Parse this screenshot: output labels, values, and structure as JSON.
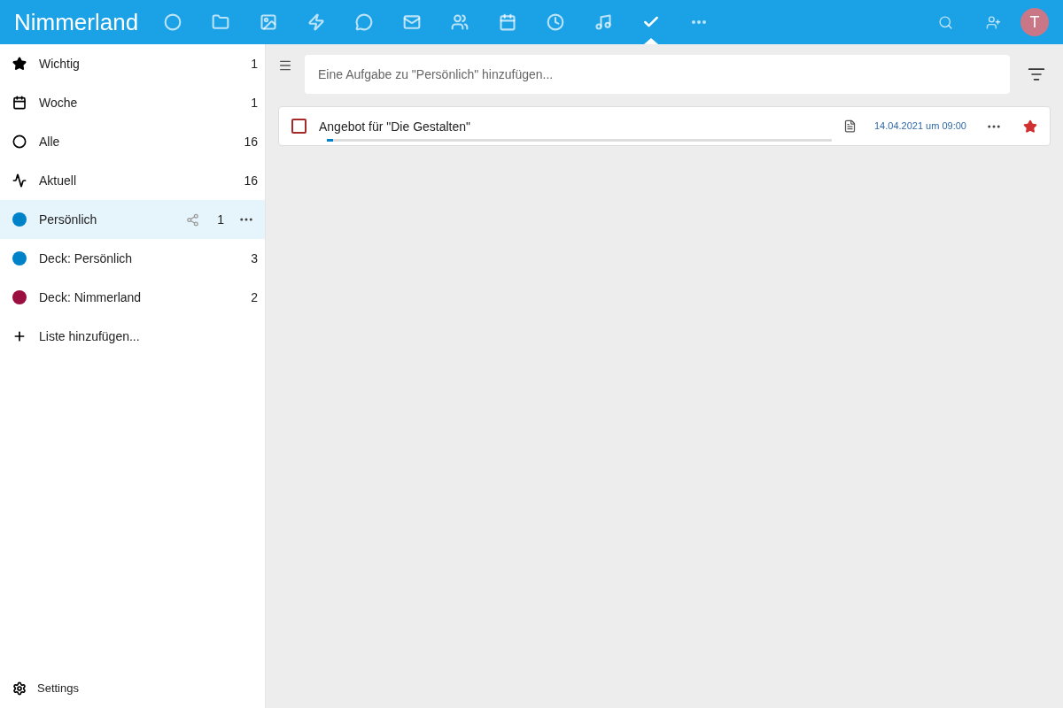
{
  "header": {
    "logo": "Nimmerland",
    "apps": [
      {
        "kind": "dashboard",
        "selected": false
      },
      {
        "kind": "files",
        "selected": false
      },
      {
        "kind": "photos",
        "selected": false
      },
      {
        "kind": "activity",
        "selected": false
      },
      {
        "kind": "talk",
        "selected": false
      },
      {
        "kind": "mail",
        "selected": false
      },
      {
        "kind": "contacts",
        "selected": false
      },
      {
        "kind": "calendar",
        "selected": false
      },
      {
        "kind": "clock",
        "selected": false
      },
      {
        "kind": "music",
        "selected": false
      },
      {
        "kind": "tasks",
        "selected": true
      },
      {
        "kind": "more",
        "selected": false
      }
    ],
    "avatar": "T"
  },
  "sidebar": {
    "items": [
      {
        "kind": "star",
        "label": "Wichtig",
        "count": "1",
        "selected": false
      },
      {
        "kind": "calendar",
        "label": "Woche",
        "count": "1",
        "selected": false
      },
      {
        "kind": "circle",
        "label": "Alle",
        "count": "16",
        "selected": false
      },
      {
        "kind": "pulse",
        "label": "Aktuell",
        "count": "16",
        "selected": false
      },
      {
        "kind": "list",
        "label": "Persönlich",
        "count": "1",
        "selected": true,
        "color": "#0082c9",
        "shared": true
      },
      {
        "kind": "list",
        "label": "Deck: Persönlich",
        "count": "3",
        "selected": false,
        "color": "#0082c9",
        "shared": false
      },
      {
        "kind": "list",
        "label": "Deck: Nimmerland",
        "count": "2",
        "selected": false,
        "color": "#9a0f3f",
        "shared": false
      },
      {
        "kind": "add",
        "label": "Liste hinzufügen..."
      }
    ],
    "settings": "Settings"
  },
  "new_task": {
    "placeholder": "Eine Aufgabe zu \"Persönlich\" hinzufügen..."
  },
  "tasks": [
    {
      "title": "Angebot für \"Die Gestalten\"",
      "checked": false,
      "has_note": true,
      "due": "14.04.2021 um 09:00",
      "starred": true,
      "level": 0.012
    }
  ]
}
